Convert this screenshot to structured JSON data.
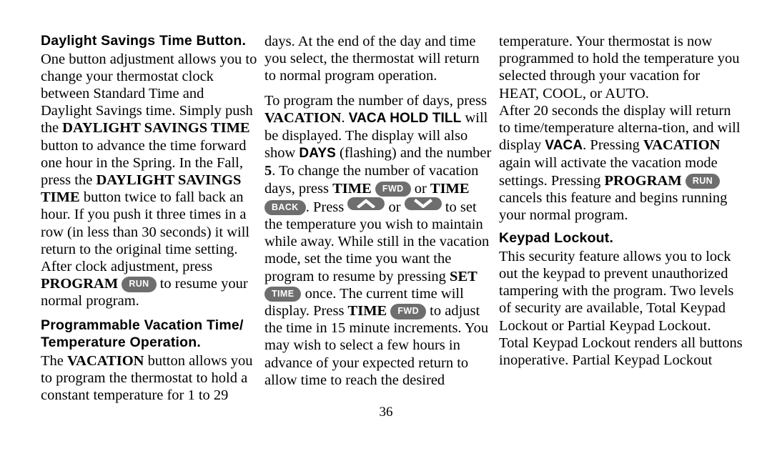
{
  "document": {
    "page_number": "36",
    "badge_color": "#6e6e6e",
    "badge_text_color": "#ffffff",
    "background_color": "#ffffff",
    "text_color": "#000000"
  },
  "column1": {
    "heading": "Daylight Savings Time Button.",
    "para1": {
      "t1": "One button adjustment allows you to change your thermostat clock between Standard Time and Daylight Savings time. Simply push the ",
      "b1": "DAYLIGHT SAVINGS TIME",
      "t2": " button to advance the time forward one hour in the Spring. In the Fall, press the ",
      "b2": "DAYLIGHT SAVINGS TIME",
      "t3": " button twice to fall back an hour. If you push it three times in a row (in less than 30 seconds) it will return to the original time setting. After clock adjustment, press ",
      "b3": "PROGRAM",
      "badge1": "RUN",
      "t4": " to resume your normal program."
    },
    "heading2_line1": "Programmable Vacation Time/",
    "heading2_line2": "Temperature Operation.",
    "para2": {
      "t1": "The ",
      "b1": "VACATION",
      "t2": " button allows you to program the thermostat to hold a constant temperature for 1 to 29"
    }
  },
  "column2": {
    "para1": "days. At the end of the day and time you select, the thermostat will return to normal program operation.",
    "para2": {
      "t1": "To program the number of days, press ",
      "b1": "VACATION",
      "t2": ". ",
      "lcd1": "VACA HOLD TILL",
      "t3": " will be displayed. The display will also show ",
      "lcd2": "DAYS",
      "t4": " (flashing) and the number ",
      "b2": "5",
      "t5": ". To change the number of vacation days, press ",
      "b3": "TIME",
      "badge1": "FWD",
      "t6": " or ",
      "b4": "TIME",
      "badge2": "BACK",
      "t7": ". Press ",
      "badge3": "up-arrow",
      "t8": " or ",
      "badge4": "down-arrow",
      "t9": " to set the temperature you wish to maintain while away. While still in the vacation mode, set the time you want the program to resume by pressing ",
      "b5": "SET",
      "badge5": "TIME",
      "t10": " once. The current time will display. Press ",
      "b6": "TIME",
      "badge6": "FWD",
      "t11": " to adjust the time in 15 minute increments. You may wish to select a few hours in advance of your expected return to allow time to reach the desired"
    }
  },
  "column3": {
    "para1": "temperature. Your thermostat is now programmed to hold the temperature you selected through your vacation for HEAT, COOL, or AUTO.",
    "para2": {
      "t1": " After 20 seconds the display will return to time/temperature alterna-tion, and will display ",
      "lcd1": "VACA",
      "t2": ". Pressing ",
      "b1": "VACATION",
      "t3": " again will activate the vacation mode settings. Pressing ",
      "b2": "PROGRAM",
      "badge1": "RUN",
      "t4": " cancels this feature and begins running your normal program."
    },
    "heading": "Keypad Lockout.",
    "para3": "This security feature allows you to lock out the keypad to prevent unauthorized tampering with the program. Two levels of security are available, Total Keypad Lockout or Partial Keypad Lockout. Total Keypad Lockout renders all buttons inoperative. Partial Keypad Lockout"
  }
}
